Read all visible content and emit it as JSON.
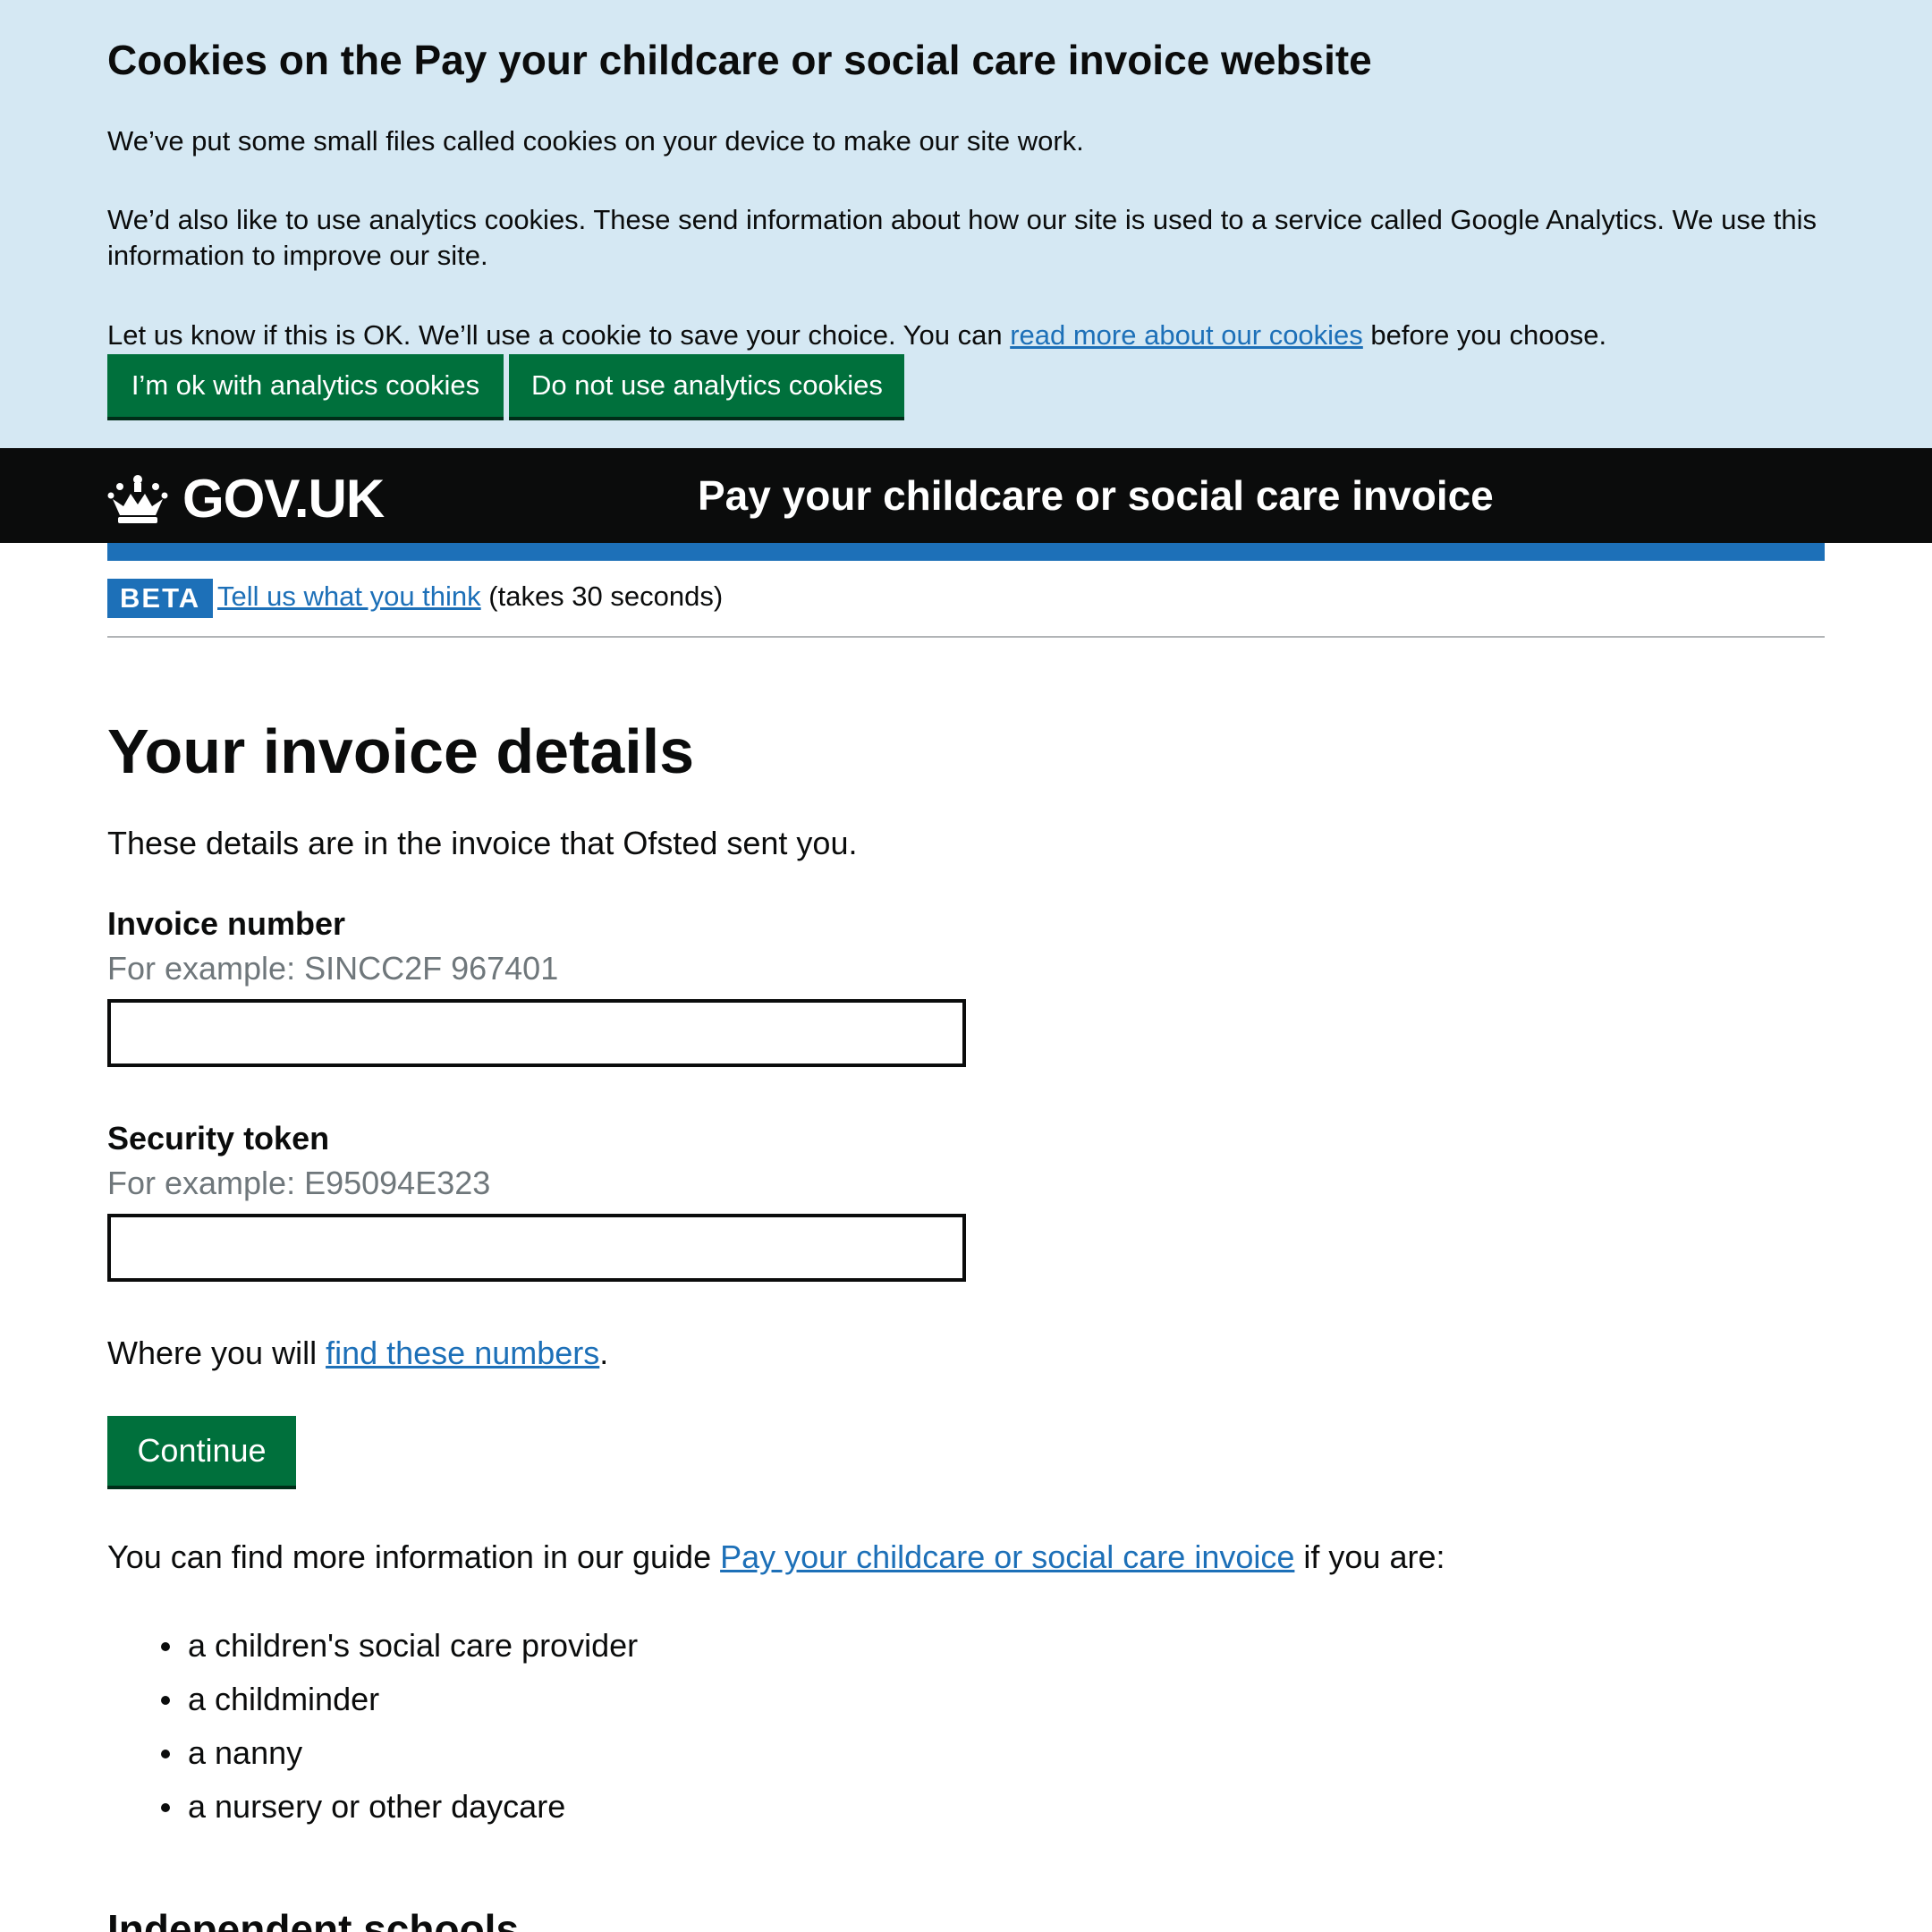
{
  "cookie_banner": {
    "title": "Cookies on the Pay your childcare or social care invoice website",
    "p1": "We’ve put some small files called cookies on your device to make our site work.",
    "p2": "We’d also like to use analytics cookies. These send information about how our site is used to a service called Google Analytics. We use this information to improve our site.",
    "p3_before": "Let us know if this is OK. We’ll use a cookie to save your choice. You can ",
    "p3_link": "read more about our cookies",
    "p3_after": " before you choose.",
    "accept_label": "I’m ok with analytics cookies",
    "reject_label": "Do not use analytics cookies"
  },
  "header": {
    "logo_text": "GOV.UK",
    "logo_icon": "crown-icon",
    "service_name": "Pay your childcare or social care invoice"
  },
  "phase_banner": {
    "tag": "BETA",
    "link": "Tell us what you think",
    "text": " (takes 30 seconds)"
  },
  "main": {
    "title": "Your invoice details",
    "lead": "These details are in the invoice that Ofsted sent you.",
    "invoice_label": "Invoice number",
    "invoice_hint": "For example: SINCC2F 967401",
    "invoice_value": "",
    "token_label": "Security token",
    "token_hint": "For example: E95094E323",
    "token_value": "",
    "find_before": "Where you will ",
    "find_link": "find these numbers",
    "find_after": ".",
    "continue_label": "Continue",
    "guide_before": "You can find more information in our guide ",
    "guide_link": "Pay your childcare or social care invoice",
    "guide_after": " if you are:",
    "list": [
      "a children's social care provider",
      "a childminder",
      "a nanny",
      "a nursery or other daycare"
    ],
    "subheading": "Independent schools"
  },
  "colors": {
    "banner_bg": "#d5e8f3",
    "header_bg": "#0b0c0c",
    "brand_blue": "#1d70b8",
    "button_green": "#00703c",
    "hint_grey": "#6f777b"
  }
}
